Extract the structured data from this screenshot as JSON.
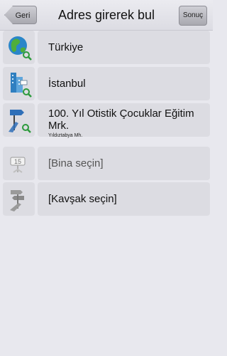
{
  "header": {
    "back_label": "Geri",
    "title": "Adres girerek bul",
    "result_label": "Sonuç"
  },
  "rows": [
    {
      "icon": "globe-search-icon",
      "label": "Türkiye"
    },
    {
      "icon": "city-buildings-search-icon",
      "label": "İstanbul"
    },
    {
      "icon": "street-sign-search-icon",
      "label": "100. Yıl Otistik Çocuklar Eğitim Mrk.",
      "sublabel": "Yıldıztabya Mh."
    },
    {
      "icon": "house-number-icon",
      "label": "[Bina seçin]",
      "badge": "15"
    },
    {
      "icon": "crossroad-sign-icon",
      "label": "[Kavşak seçin]"
    }
  ]
}
